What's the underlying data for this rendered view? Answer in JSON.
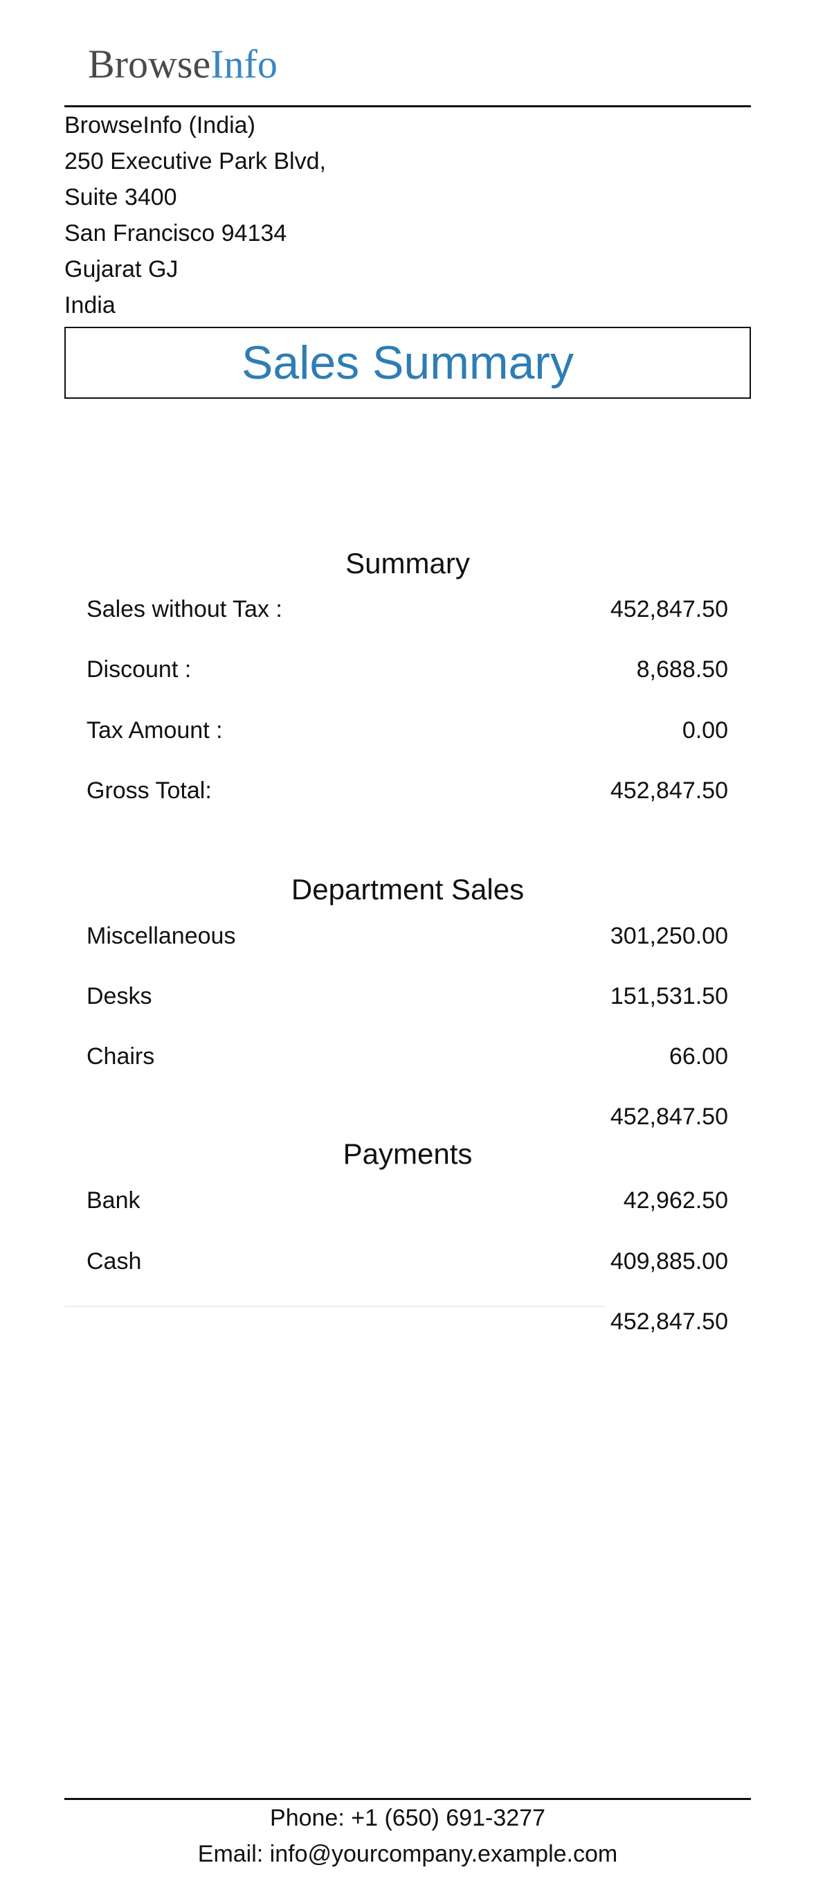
{
  "logo": {
    "part1": "Browse",
    "part2": "Info"
  },
  "company": {
    "lines": [
      "BrowseInfo (India)",
      "250 Executive Park Blvd,",
      "Suite 3400",
      "San Francisco 94134",
      "Gujarat GJ",
      "India"
    ]
  },
  "report_title": "Sales Summary",
  "summary": {
    "heading": "Summary",
    "rows": [
      {
        "label": "Sales without Tax :",
        "value": "452,847.50"
      },
      {
        "label": "Discount :",
        "value": "8,688.50"
      },
      {
        "label": "Tax Amount :",
        "value": "0.00"
      },
      {
        "label": "Gross Total:",
        "value": "452,847.50"
      }
    ]
  },
  "departments": {
    "heading": "Department Sales",
    "rows": [
      {
        "label": "Miscellaneous",
        "value": "301,250.00"
      },
      {
        "label": "Desks",
        "value": "151,531.50"
      },
      {
        "label": "Chairs",
        "value": "66.00"
      }
    ],
    "total": "452,847.50"
  },
  "payments": {
    "heading": "Payments",
    "rows": [
      {
        "label": "Bank",
        "value": "42,962.50"
      },
      {
        "label": "Cash",
        "value": "409,885.00"
      }
    ],
    "total": "452,847.50"
  },
  "footer": {
    "phone": "Phone: +1 (650) 691-3277",
    "email": "Email: info@yourcompany.example.com"
  }
}
